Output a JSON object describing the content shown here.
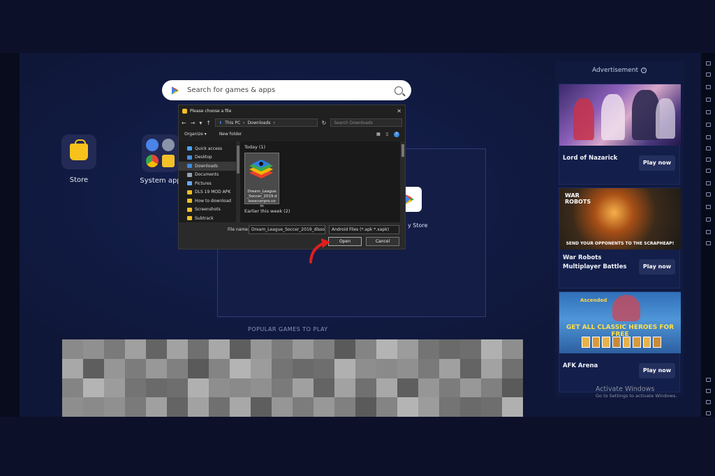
{
  "search": {
    "placeholder": "Search for games & apps"
  },
  "home_apps": {
    "store": "Store",
    "system_apps": "System app",
    "play_store": "y Store"
  },
  "popular_heading": "POPULAR GAMES TO PLAY",
  "file_dialog": {
    "title": "Please choose a file",
    "close": "✕",
    "address": [
      "This PC",
      "Downloads"
    ],
    "search_placeholder": "Search Downloads",
    "toolbar": {
      "organize": "Organize ▾",
      "new_folder": "New folder"
    },
    "nav_items": [
      {
        "label": "Quick access",
        "icon_color": "#4aa3ff"
      },
      {
        "label": "Desktop",
        "icon_color": "#4a8fe0"
      },
      {
        "label": "Downloads",
        "icon_color": "#3c8ae0",
        "selected": true
      },
      {
        "label": "Documents",
        "icon_color": "#9aa3b5"
      },
      {
        "label": "Pictures",
        "icon_color": "#6aa7e8"
      },
      {
        "label": "DLS 19 MOD APK",
        "icon_color": "#f2c028"
      },
      {
        "label": "How to download",
        "icon_color": "#f2c028"
      },
      {
        "label": "Screenshots",
        "icon_color": "#f2c028"
      },
      {
        "label": "Subtrack",
        "icon_color": "#f2c028"
      }
    ],
    "group_today": "Today (1)",
    "file_name_tile": "Dream_League_Soccer_2019.dlssoccerpro.com",
    "group_earlier": "Earlier this week (2)",
    "file_name_label": "File name:",
    "file_name_value": "Dream_League_Soccer_2019_dlsso",
    "file_type": "Android Files (*.apk *.xapk)",
    "open_button": "Open",
    "cancel_button": "Cancel"
  },
  "ads": {
    "heading": "Advertisement",
    "items": [
      {
        "name": "Lord of Nazarick",
        "button": "Play now",
        "banner_text": ""
      },
      {
        "name": "War Robots Multiplayer Battles",
        "button": "Play now",
        "banner_text": "SEND YOUR OPPONENTS TO THE SCRAPHEAP!",
        "logo": "WAR ROBOTS"
      },
      {
        "name": "AFK Arena",
        "button": "Play now",
        "banner_text": "GET ALL CLASSIC HEROES FOR FREE",
        "logo": "Ascended"
      }
    ]
  },
  "watermark": {
    "line1": "Activate Windows",
    "line2": "Go to Settings to activate Windows."
  },
  "colors": {
    "background": "#0b0f24",
    "screen": "#0f1739",
    "accent_yellow": "#f7c21b",
    "dialog": "#202020"
  }
}
